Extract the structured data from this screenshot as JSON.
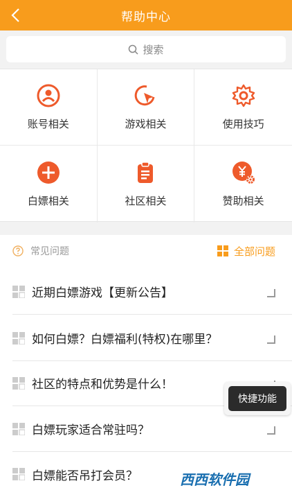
{
  "header": {
    "title": "帮助中心"
  },
  "search": {
    "placeholder": "搜索"
  },
  "categories": [
    {
      "label": "账号相关",
      "icon": "user-circle-icon"
    },
    {
      "label": "游戏相关",
      "icon": "cursor-circle-icon"
    },
    {
      "label": "使用技巧",
      "icon": "gear-icon"
    },
    {
      "label": "白嫖相关",
      "icon": "plus-circle-icon"
    },
    {
      "label": "社区相关",
      "icon": "clipboard-icon"
    },
    {
      "label": "赞助相关",
      "icon": "yen-gear-icon"
    }
  ],
  "faq": {
    "title": "常见问题",
    "all_label": "全部问题",
    "items": [
      "近期白嫖游戏【更新公告】",
      "如何白嫖？白嫖福利(特权)在哪里？",
      "社区的特点和优势是什么！",
      "白嫖玩家适合常驻吗？",
      "白嫖能否吊打会员？"
    ]
  },
  "quick": {
    "label": "快捷功能"
  },
  "watermark": {
    "text": "西西软件园"
  },
  "colors": {
    "accent": "#f89c1c",
    "icon_red": "#ee5a2b"
  }
}
